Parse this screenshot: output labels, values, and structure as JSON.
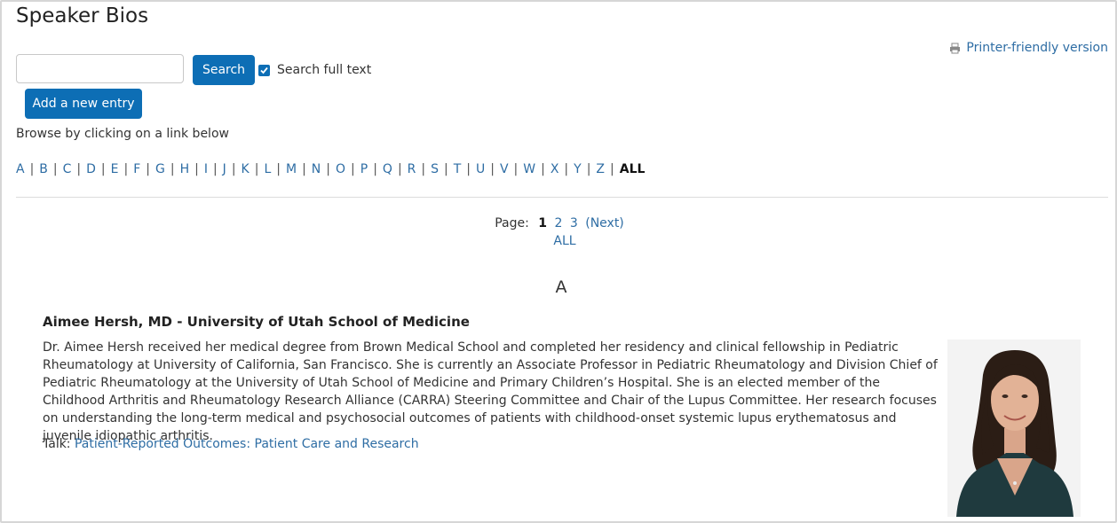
{
  "page": {
    "title": "Speaker Bios",
    "printer_link": "Printer-friendly version"
  },
  "search": {
    "input_value": "",
    "button_label": "Search",
    "full_text_checked": true,
    "full_text_label": "Search full text"
  },
  "add_entry_label": "Add a new entry",
  "browse_text": "Browse by clicking on a link below",
  "alphabet": [
    "A",
    "B",
    "C",
    "D",
    "E",
    "F",
    "G",
    "H",
    "I",
    "J",
    "K",
    "L",
    "M",
    "N",
    "O",
    "P",
    "Q",
    "R",
    "S",
    "T",
    "U",
    "V",
    "W",
    "X",
    "Y",
    "Z"
  ],
  "alphabet_all": "ALL",
  "pager": {
    "label": "Page:",
    "current": "1",
    "pages": [
      "2",
      "3"
    ],
    "next": "(Next)",
    "all": "ALL"
  },
  "section_letter": "A",
  "entry": {
    "name": "Aimee Hersh, MD - University of Utah School of Medicine",
    "bio": "Dr. Aimee Hersh received her medical degree from Brown Medical School and completed her residency and clinical fellowship in Pediatric Rheumatology at University of California, San Francisco. She is currently an Associate Professor in Pediatric Rheumatology and Division Chief of Pediatric Rheumatology at the University of Utah School of Medicine and Primary Children’s Hospital. She is an elected member of the Childhood Arthritis and Rheumatology Research Alliance (CARRA) Steering Committee and Chair of the Lupus Committee. Her research focuses on understanding the long-term medical and psychosocial outcomes of patients with childhood-onset systemic lupus erythematosus and juvenile idiopathic arthritis.",
    "talk_label": "Talk:",
    "talk_title": "Patient-Reported Outcomes: Patient Care and Research"
  },
  "colors": {
    "accent": "#0d6eb5",
    "link": "#2e6da4"
  }
}
